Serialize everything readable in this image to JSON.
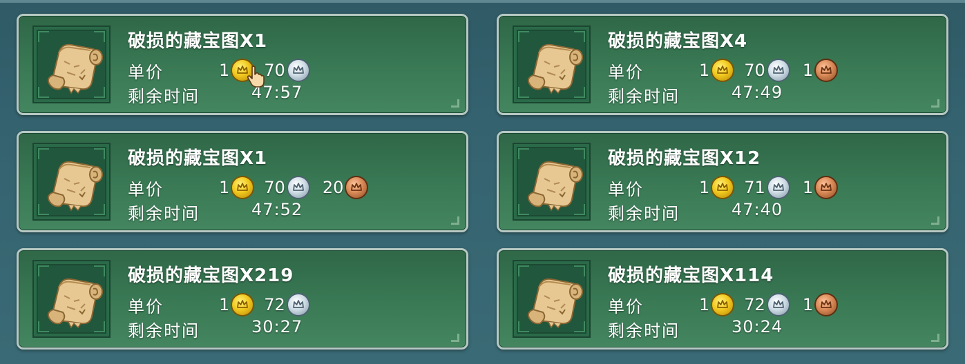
{
  "listings": [
    {
      "title": "破损的藏宝图X1",
      "price_label": "单价",
      "gold": "1",
      "silver": "70",
      "copper": "",
      "time_label": "剩余时间",
      "time": "47:57"
    },
    {
      "title": "破损的藏宝图X4",
      "price_label": "单价",
      "gold": "1",
      "silver": "70",
      "copper": "1",
      "time_label": "剩余时间",
      "time": "47:49"
    },
    {
      "title": "破损的藏宝图X1",
      "price_label": "单价",
      "gold": "1",
      "silver": "70",
      "copper": "20",
      "time_label": "剩余时间",
      "time": "47:52"
    },
    {
      "title": "破损的藏宝图X12",
      "price_label": "单价",
      "gold": "1",
      "silver": "71",
      "copper": "1",
      "time_label": "剩余时间",
      "time": "47:40"
    },
    {
      "title": "破损的藏宝图X219",
      "price_label": "单价",
      "gold": "1",
      "silver": "72",
      "copper": "",
      "time_label": "剩余时间",
      "time": "30:27"
    },
    {
      "title": "破损的藏宝图X114",
      "price_label": "单价",
      "gold": "1",
      "silver": "72",
      "copper": "1",
      "time_label": "剩余时间",
      "time": "30:24"
    }
  ],
  "icons": {
    "item": "treasure-map-scroll-icon",
    "gold": "gold-coin-icon",
    "silver": "silver-coin-icon",
    "copper": "copper-coin-icon",
    "cursor": "hand-pointer-cursor-icon"
  },
  "colors": {
    "card_bg": "#3a7a55",
    "card_border": "#b7c9c3",
    "gold": "#f1c81e",
    "silver": "#cfdde6",
    "copper": "#d98a58"
  }
}
